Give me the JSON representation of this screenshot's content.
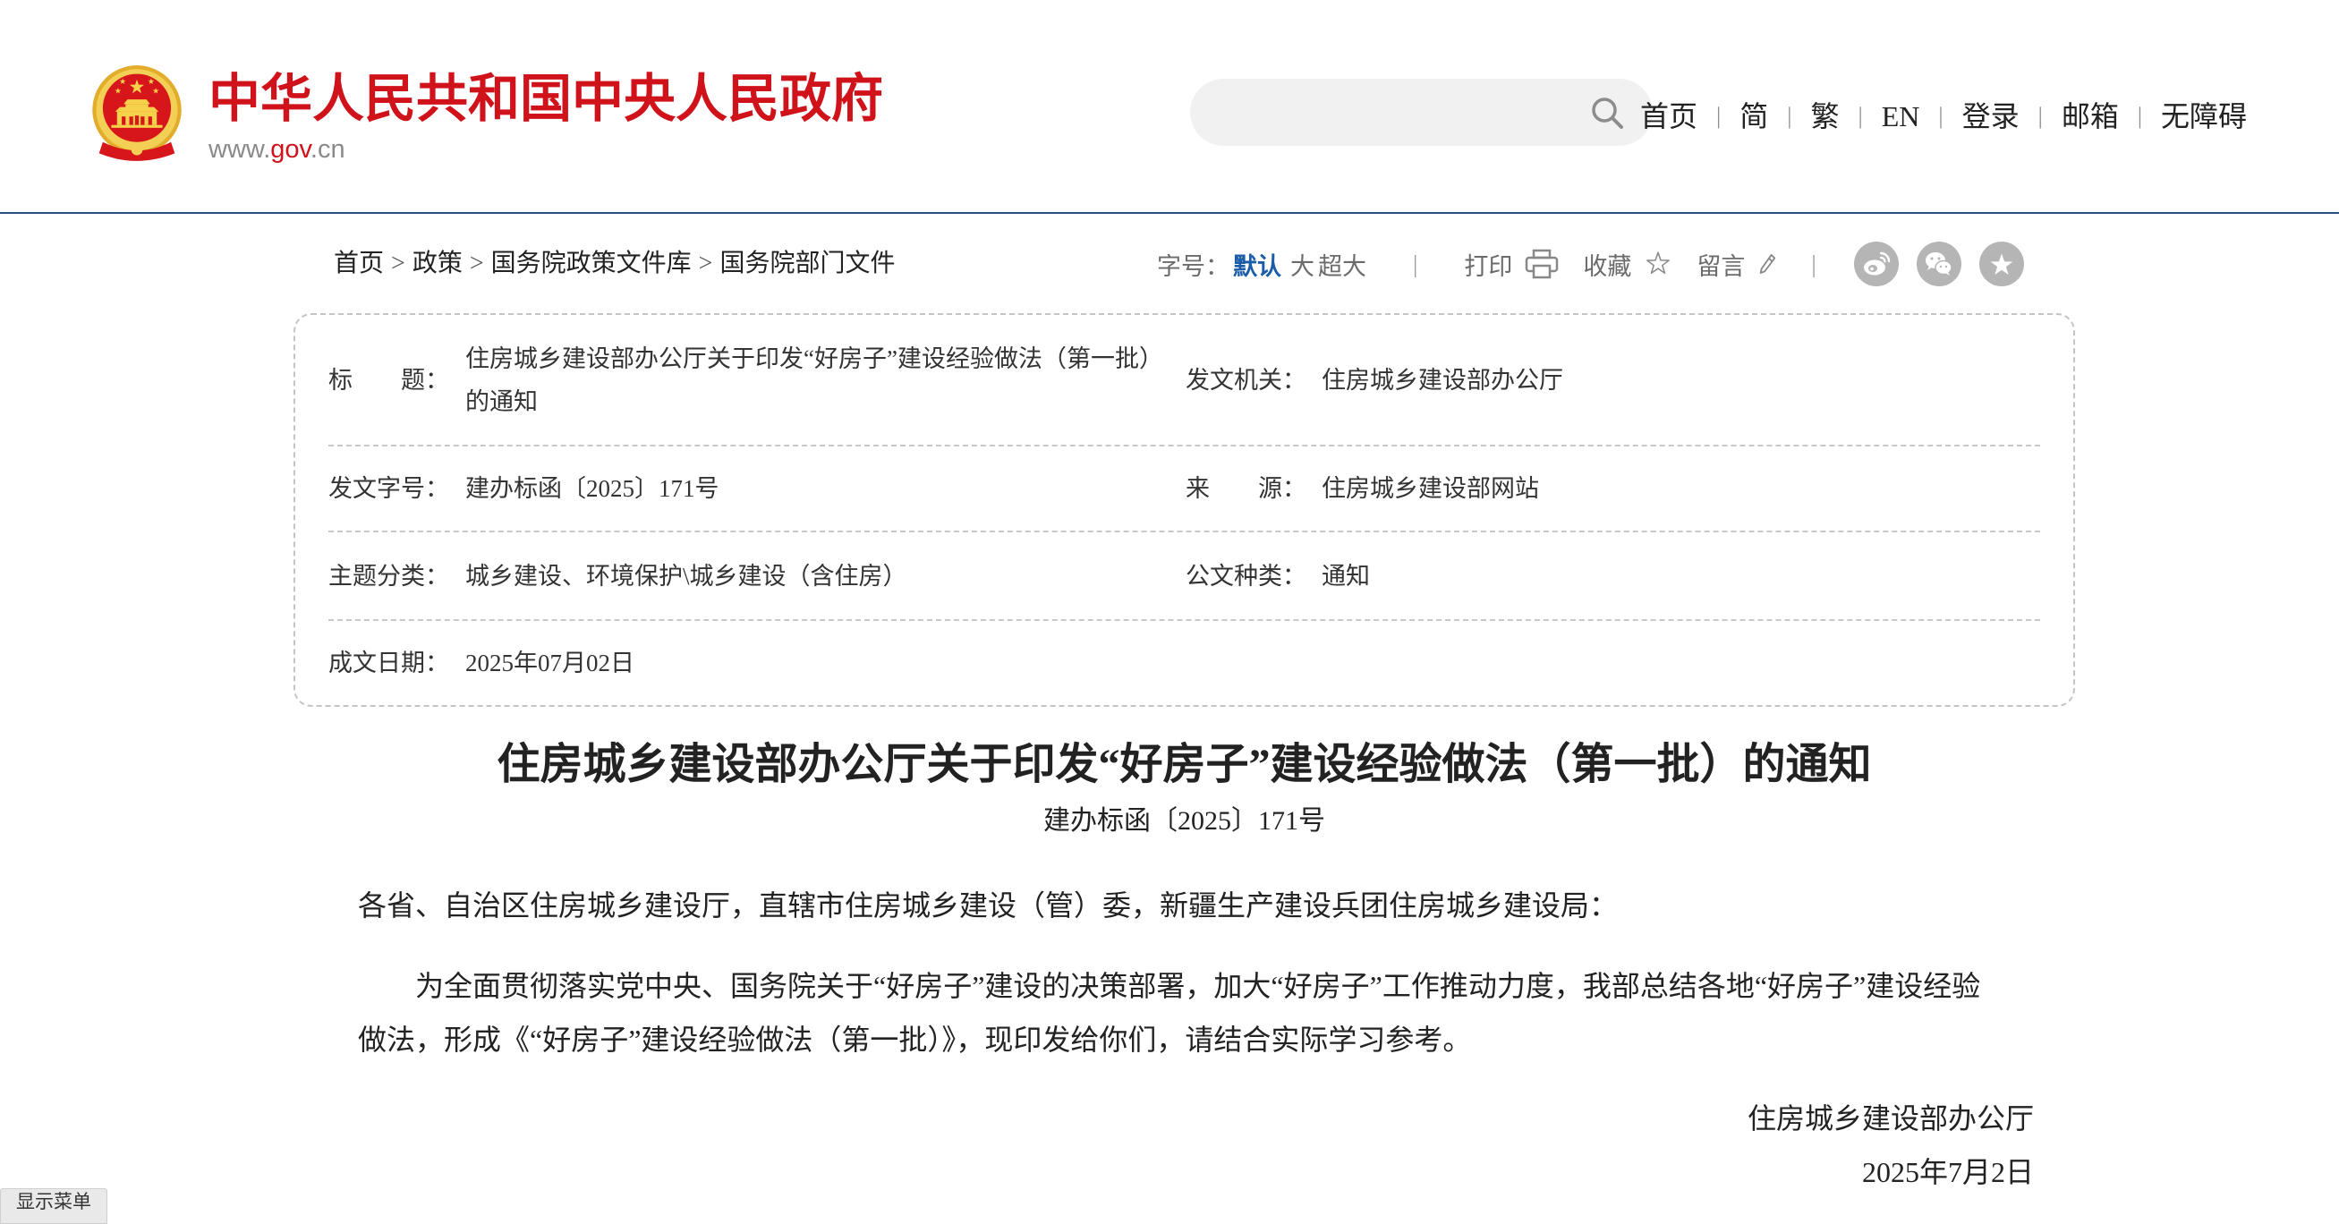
{
  "header": {
    "site_title": "中华人民共和国中央人民政府",
    "url": {
      "prefix": "www.",
      "domain": "gov",
      "suffix": ".cn"
    },
    "emblem_icon": "national-emblem-icon",
    "search_icon": "search-icon",
    "nav": [
      {
        "label": "首页"
      },
      {
        "label": "简"
      },
      {
        "label": "繁"
      },
      {
        "label": "EN"
      },
      {
        "label": "登录"
      },
      {
        "label": "邮箱"
      },
      {
        "label": "无障碍"
      }
    ],
    "nav_separator": "|"
  },
  "breadcrumb": {
    "items": [
      "首页",
      "政策",
      "国务院政策文件库",
      "国务院部门文件"
    ],
    "separator": ">"
  },
  "tools": {
    "font_size_label": "字号：",
    "font_sizes": [
      "默认",
      "大",
      "超大"
    ],
    "selected_font_size_index": 0,
    "separator": "|",
    "print": {
      "label": "打印",
      "icon": "printer-icon"
    },
    "favorite": {
      "label": "收藏",
      "icon": "star-outline-icon"
    },
    "comment": {
      "label": "留言",
      "icon": "pencil-icon"
    },
    "share_icons": [
      "weibo-icon",
      "wechat-icon",
      "qzone-icon"
    ]
  },
  "info_table": {
    "title": {
      "label": "标　　题：",
      "value": "住房城乡建设部办公厅关于印发“好房子”建设经验做法（第一批）的通知"
    },
    "issuer": {
      "label": "发文机关：",
      "value": "住房城乡建设部办公厅"
    },
    "doc_number": {
      "label": "发文字号：",
      "value": "建办标函〔2025〕171号"
    },
    "source": {
      "label": "来　　源：",
      "value": "住房城乡建设部网站"
    },
    "category": {
      "label": "主题分类：",
      "value": "城乡建设、环境保护\\城乡建设（含住房）"
    },
    "doc_type": {
      "label": "公文种类：",
      "value": "通知"
    },
    "date": {
      "label": "成文日期：",
      "value": "2025年07月02日"
    }
  },
  "article": {
    "title": "住房城乡建设部办公厅关于印发“好房子”建设经验做法（第一批）的通知",
    "doc_number": "建办标函〔2025〕171号",
    "salutation": "各省、自治区住房城乡建设厅，直辖市住房城乡建设（管）委，新疆生产建设兵团住房城乡建设局：",
    "paragraphs": [
      "为全面贯彻落实党中央、国务院关于“好房子”建设的决策部署，加大“好房子”工作推动力度，我部总结各地“好房子”建设经验做法，形成《“好房子”建设经验做法（第一批）》，现印发给你们，请结合实际学习参考。"
    ],
    "signature": "住房城乡建设部办公厅",
    "date": "2025年7月2日"
  },
  "menu_toggle": {
    "label": "显示菜单"
  },
  "theme": {
    "brand_red": "#d0121b",
    "link_blue": "#1a5ca8",
    "rule_blue": "#2b4d86",
    "share_icon_gray": "#b5b5b5"
  }
}
